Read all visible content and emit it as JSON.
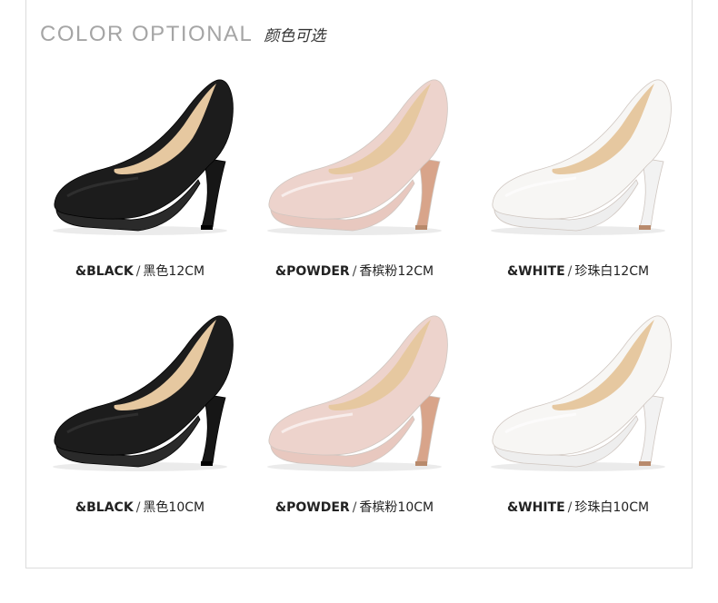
{
  "header": {
    "title_en": "COLOR OPTIONAL",
    "title_cn": "颜色可选"
  },
  "products": [
    {
      "code": "&BLACK",
      "desc": "黑色12CM",
      "color": "#1c1c1c",
      "sole": "#2a2a2a",
      "heel": "#161616"
    },
    {
      "code": "&POWDER",
      "desc": "香槟粉12CM",
      "color": "#edd3cc",
      "sole": "#e8c8bf",
      "heel": "#d8a48a"
    },
    {
      "code": "&WHITE",
      "desc": "珍珠白12CM",
      "color": "#f7f6f4",
      "sole": "#eeeeee",
      "heel": "#f2f2f2"
    },
    {
      "code": "&BLACK",
      "desc": "黑色10CM",
      "color": "#1c1c1c",
      "sole": "#2a2a2a",
      "heel": "#161616"
    },
    {
      "code": "&POWDER",
      "desc": "香槟粉10CM",
      "color": "#edd3cc",
      "sole": "#e8c8bf",
      "heel": "#d8a48a"
    },
    {
      "code": "&WHITE",
      "desc": "珍珠白10CM",
      "color": "#f7f6f4",
      "sole": "#eeeeee",
      "heel": "#f2f2f2"
    }
  ],
  "lining_color": "#e6c8a0",
  "separator": "/"
}
